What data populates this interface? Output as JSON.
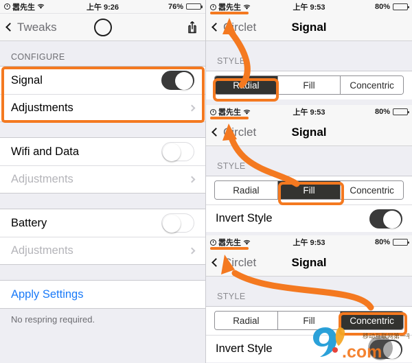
{
  "left_phone": {
    "status_bar": {
      "alarm_icon": "alarm-clock-icon",
      "carrier": "嚣先生",
      "wifi_icon": "wifi-icon",
      "time": "上午 9:26",
      "battery_percent": "76%",
      "battery_level": 76
    },
    "nav": {
      "back_label": "Tweaks",
      "center_icon": "circle-logo-icon",
      "action_icon": "share-icon"
    },
    "section_header": "CONFIGURE",
    "rows": [
      {
        "label": "Signal",
        "control": "switch",
        "state": "on",
        "disabled": false
      },
      {
        "label": "Adjustments",
        "control": "chevron",
        "disabled": false
      },
      {
        "label": "Wifi and Data",
        "control": "switch",
        "state": "off",
        "disabled": false
      },
      {
        "label": "Adjustments",
        "control": "chevron",
        "disabled": true
      },
      {
        "label": "Battery",
        "control": "switch",
        "state": "off",
        "disabled": false
      },
      {
        "label": "Adjustments",
        "control": "chevron",
        "disabled": true
      }
    ],
    "apply_label": "Apply Settings",
    "footnote": "No respring required."
  },
  "right_panels": [
    {
      "status_bar": {
        "carrier": "嚣先生",
        "time": "上午 9:53",
        "battery_percent": "80%",
        "battery_level": 80
      },
      "nav": {
        "back_label": "Circlet",
        "title": "Signal"
      },
      "section_header": "STYLE",
      "segments": [
        "Radial",
        "Fill",
        "Concentric"
      ],
      "selected_segment": "Radial",
      "invert_row": null
    },
    {
      "status_bar": {
        "carrier": "嚣先生",
        "time": "上午 9:53",
        "battery_percent": "80%",
        "battery_level": 80
      },
      "nav": {
        "back_label": "Circlet",
        "title": "Signal"
      },
      "section_header": "STYLE",
      "segments": [
        "Radial",
        "Fill",
        "Concentric"
      ],
      "selected_segment": "Fill",
      "invert_row": {
        "label": "Invert Style",
        "state": "on"
      }
    },
    {
      "status_bar": {
        "carrier": "嚣先生",
        "time": "上午 9:53",
        "battery_percent": "80%",
        "battery_level": 80
      },
      "nav": {
        "back_label": "Circlet",
        "title": "Signal"
      },
      "section_header": "STYLE",
      "segments": [
        "Radial",
        "Fill",
        "Concentric"
      ],
      "selected_segment": "Concentric",
      "invert_row": {
        "label": "Invert Style",
        "state": "on"
      }
    }
  ],
  "annotations": {
    "accent_color": "#f47920",
    "highlight_left_rows": "Signal + Adjustments group",
    "arrow_count": 3
  },
  "watermark": {
    "logo_text": "9",
    "domain_text": ".com",
    "tagline": "移动互联网第一平台"
  }
}
